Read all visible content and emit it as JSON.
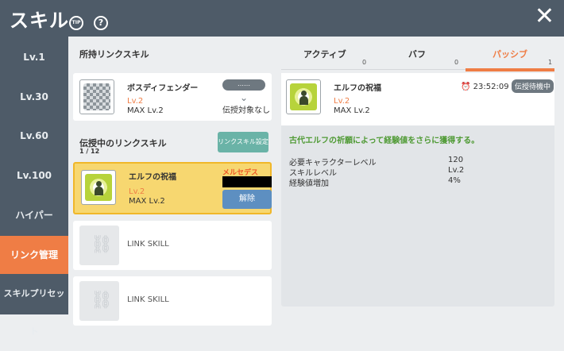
{
  "header": {
    "title": "スキル",
    "tip": "TIP",
    "help": "?",
    "close": "✕"
  },
  "sidebar": {
    "items": [
      {
        "label": "Lv.1"
      },
      {
        "label": "Lv.30"
      },
      {
        "label": "Lv.60"
      },
      {
        "label": "Lv.100"
      },
      {
        "label": "ハイパー"
      },
      {
        "label": "リンク管理",
        "active": true
      },
      {
        "label": "スキルプリセット"
      }
    ]
  },
  "owned": {
    "title": "所持リンクスキル",
    "skill": {
      "name": "ボスディフェンダー",
      "lv": "Lv.2",
      "max": "MAX Lv.2",
      "pill": "……",
      "status": "伝授対象なし"
    }
  },
  "teaching": {
    "title": "伝授中のリンクスキル",
    "count": "1 / 12",
    "settings_button": "リンクスキル設定",
    "skill": {
      "name": "エルフの祝福",
      "lv": "Lv.2",
      "max": "MAX Lv.2",
      "sender": "メルセデス",
      "release_button": "解除"
    },
    "empty_slots": [
      {
        "label": "LINK SKILL"
      },
      {
        "label": "LINK SKILL"
      }
    ]
  },
  "tabs": [
    {
      "label": "アクティブ",
      "count": "0"
    },
    {
      "label": "バフ",
      "count": "0"
    },
    {
      "label": "パッシブ",
      "count": "1",
      "active": true
    }
  ],
  "detail": {
    "name": "エルフの祝福",
    "lv": "Lv.2",
    "max": "MAX Lv.2",
    "timer": "23:52:09",
    "status": "伝授待機中",
    "description": "古代エルフの祈願によって経験値をさらに獲得する。",
    "stats": [
      {
        "label": "必要キャラクターレベル",
        "value": "120"
      },
      {
        "label": "スキルレベル",
        "value": "Lv.2"
      },
      {
        "label": "経験値増加",
        "value": "4%"
      }
    ]
  },
  "colors": {
    "accent": "#ef7d45",
    "header": "#4e5b68",
    "highlight": "#f7d770",
    "release": "#5d8fc1",
    "settings": "#6ab3a7"
  }
}
